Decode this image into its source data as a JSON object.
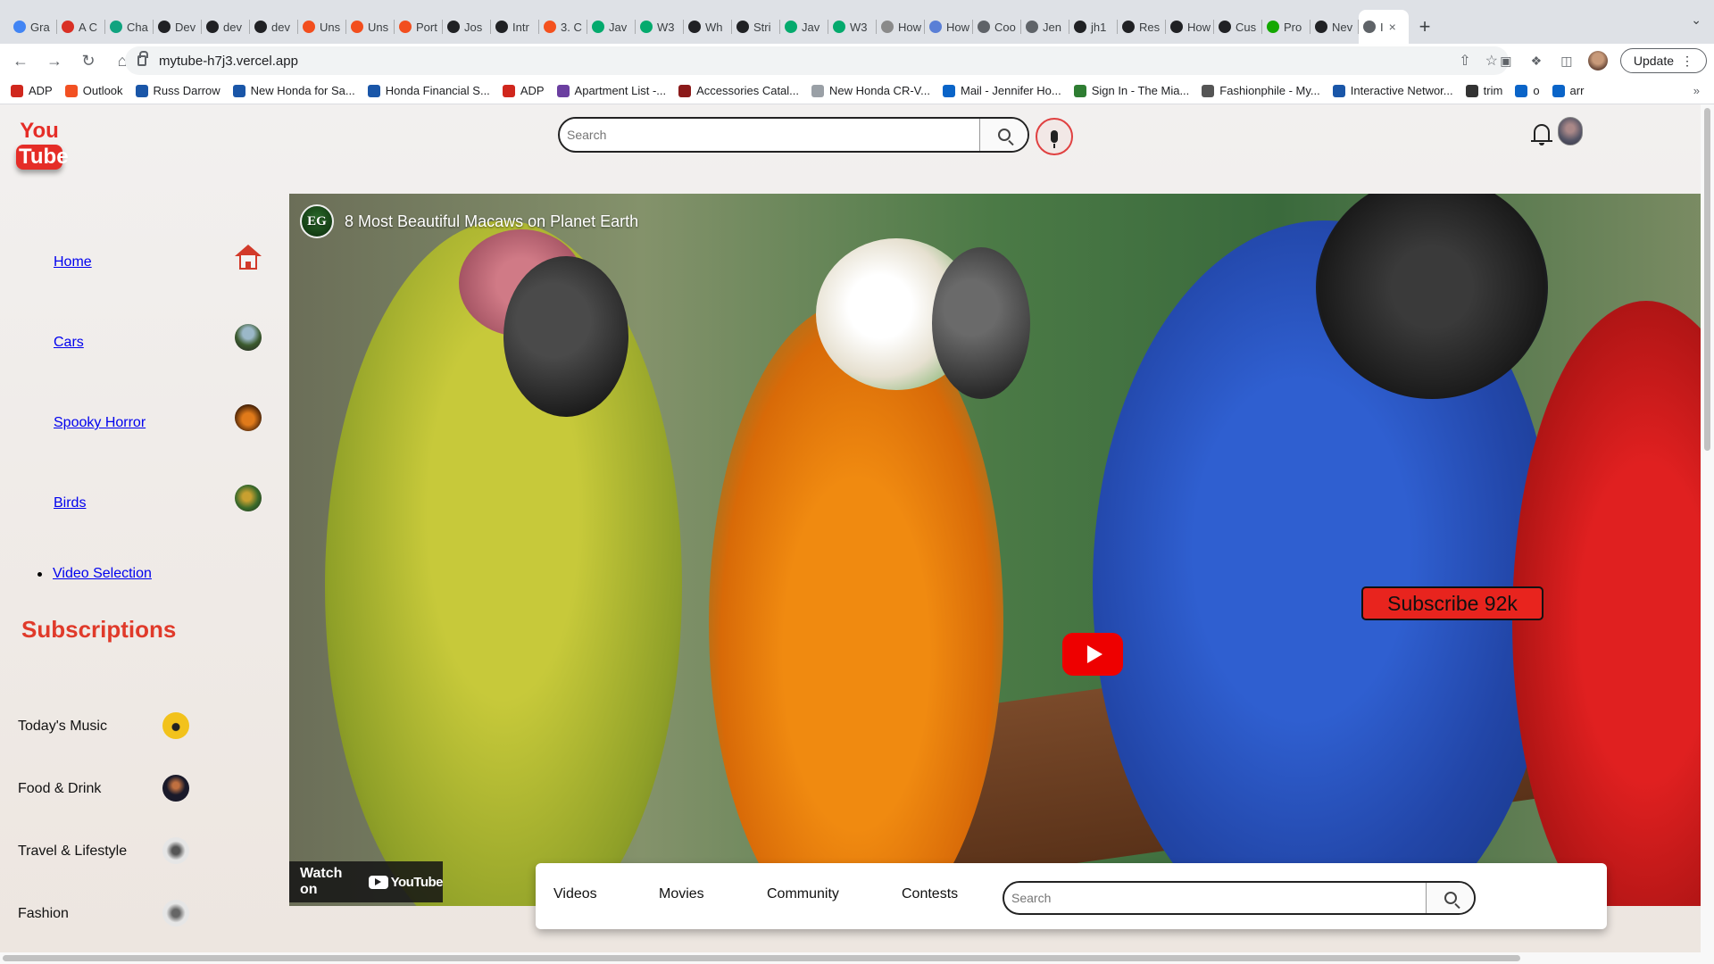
{
  "browser": {
    "tabs": [
      {
        "label": "Gra",
        "icon": "google-icon",
        "color": "#4285f4"
      },
      {
        "label": "A C",
        "icon": "asterisk-icon",
        "color": "#d93025"
      },
      {
        "label": "Cha",
        "icon": "chatgpt-icon",
        "color": "#10a37f"
      },
      {
        "label": "Dev",
        "icon": "info-icon",
        "color": "#202124"
      },
      {
        "label": "dev",
        "icon": "github-icon",
        "color": "#202124"
      },
      {
        "label": "dev",
        "icon": "github-icon",
        "color": "#202124"
      },
      {
        "label": "Uns",
        "icon": "figma-icon",
        "color": "#f24e1e"
      },
      {
        "label": "Uns",
        "icon": "figma-icon",
        "color": "#f24e1e"
      },
      {
        "label": "Port",
        "icon": "figma-icon",
        "color": "#f24e1e"
      },
      {
        "label": "Jos",
        "icon": "bag-icon",
        "color": "#202124"
      },
      {
        "label": "Intr",
        "icon": "gear-icon",
        "color": "#202124"
      },
      {
        "label": "3. C",
        "icon": "circle-icon",
        "color": "#f4511e"
      },
      {
        "label": "Jav",
        "icon": "w3-icon",
        "color": "#04aa6d"
      },
      {
        "label": "W3",
        "icon": "w3-icon",
        "color": "#04aa6d"
      },
      {
        "label": "Wh",
        "icon": "m-icon",
        "color": "#202124"
      },
      {
        "label": "Stri",
        "icon": "m-icon",
        "color": "#202124"
      },
      {
        "label": "Jav",
        "icon": "w3-icon",
        "color": "#04aa6d"
      },
      {
        "label": "W3",
        "icon": "w3-icon",
        "color": "#04aa6d"
      },
      {
        "label": "How",
        "icon": "puzzle-icon",
        "color": "#8a8a8a"
      },
      {
        "label": "How",
        "icon": "tm-icon",
        "color": "#5a7fd6"
      },
      {
        "label": "Coo",
        "icon": "globe-icon",
        "color": "#5f6368"
      },
      {
        "label": "Jen",
        "icon": "globe-icon",
        "color": "#5f6368"
      },
      {
        "label": "jh1",
        "icon": "github-icon",
        "color": "#202124"
      },
      {
        "label": "Res",
        "icon": "box-icon",
        "color": "#202124"
      },
      {
        "label": "How",
        "icon": "sk-icon",
        "color": "#202124"
      },
      {
        "label": "Cus",
        "icon": "sk-icon",
        "color": "#202124"
      },
      {
        "label": "Pro",
        "icon": "upwork-icon",
        "color": "#14a800"
      },
      {
        "label": "Nev",
        "icon": "circle-icon",
        "color": "#202124"
      },
      {
        "label": "I",
        "icon": "globe-icon",
        "color": "#5f6368",
        "active": true
      }
    ],
    "url": "mytube-h7j3.vercel.app",
    "update_label": "Update",
    "bookmarks": [
      {
        "label": "ADP",
        "color": "#d0271d"
      },
      {
        "label": "Outlook",
        "color": "#f25022"
      },
      {
        "label": "Russ Darrow",
        "color": "#1a56a8"
      },
      {
        "label": "New Honda for Sa...",
        "color": "#1a56a8"
      },
      {
        "label": "Honda Financial S...",
        "color": "#1a56a8"
      },
      {
        "label": "ADP",
        "color": "#d0271d"
      },
      {
        "label": "Apartment List -...",
        "color": "#6b3fa0"
      },
      {
        "label": "Accessories Catal...",
        "color": "#8b1a1a"
      },
      {
        "label": "New Honda CR-V...",
        "color": "#9aa0a6"
      },
      {
        "label": "Mail - Jennifer Ho...",
        "color": "#0a64c8"
      },
      {
        "label": "Sign In - The Mia...",
        "color": "#2e7d32"
      },
      {
        "label": "Fashionphile - My...",
        "color": "#555555"
      },
      {
        "label": "Interactive Networ...",
        "color": "#1a56a8"
      },
      {
        "label": "trim",
        "color": "#333333"
      },
      {
        "label": "o",
        "color": "#0a64c8"
      },
      {
        "label": "arr",
        "color": "#0a64c8"
      }
    ]
  },
  "header": {
    "logo_top": "You",
    "logo_bottom": "Tube",
    "search_placeholder": "Search"
  },
  "sidebar": {
    "nav": [
      {
        "label": "Home",
        "icon": "home-icon"
      },
      {
        "label": "Cars",
        "icon": "cars-thumb-icon",
        "color": "#3b5a2e"
      },
      {
        "label": "Spooky Horror",
        "icon": "pumpkin-thumb-icon",
        "color": "#c05a10"
      },
      {
        "label": "Birds",
        "icon": "bird-thumb-icon",
        "color": "#6a7a2a"
      }
    ],
    "video_selection": "Video Selection",
    "subscriptions_title": "Subscriptions",
    "subscriptions": [
      {
        "label": "Today's Music",
        "icon": "headphones-icon",
        "color": "#f2c21b"
      },
      {
        "label": "Food & Drink",
        "icon": "food-thumb-icon",
        "color": "#1a1a2a"
      },
      {
        "label": "Travel & Lifestyle",
        "icon": "travel-thumb-icon",
        "color": "#cfcfcf"
      },
      {
        "label": "Fashion",
        "icon": "fashion-thumb-icon",
        "color": "#cfcfcf"
      }
    ]
  },
  "video": {
    "channel_initials": "EG",
    "title": "8 Most Beautiful Macaws on Planet Earth",
    "subscribe_label": "Subscribe 92k",
    "watch_on": "Watch on",
    "youtube_word": "YouTube"
  },
  "bottom_bar": {
    "links": [
      "Videos",
      "Movies",
      "Community",
      "Contests"
    ],
    "search_placeholder": "Search"
  },
  "colors": {
    "accent_red": "#e52d27",
    "link_blue": "#0000ee",
    "subs_title": "#e03a2a"
  }
}
